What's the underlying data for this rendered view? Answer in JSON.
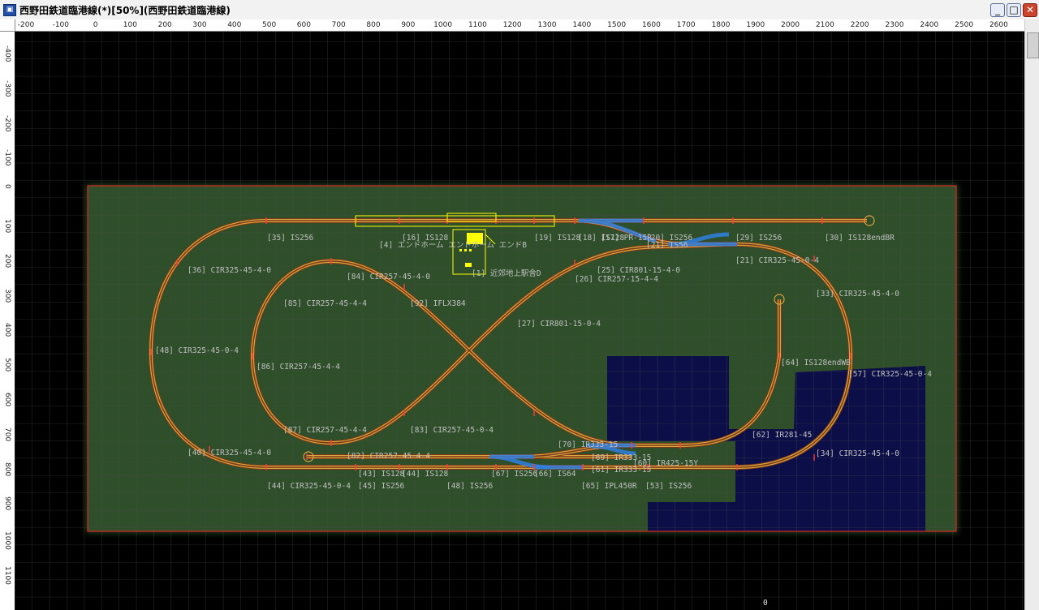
{
  "window": {
    "title": "西野田鉄道臨港線(*)[50%](西野田鉄道臨港線)",
    "app_icon": "train-icon",
    "minimize": "_",
    "maximize": "□",
    "close": "✕"
  },
  "ruler": {
    "x_ticks": [
      "-200",
      "-100",
      "0",
      "100",
      "200",
      "300",
      "400",
      "500",
      "600",
      "700",
      "800",
      "900",
      "1000",
      "1100",
      "1200",
      "1300",
      "1400",
      "1500",
      "1600",
      "1700",
      "1800",
      "1900",
      "2000",
      "2100",
      "2200",
      "2300",
      "2400",
      "2500",
      "2600"
    ],
    "y_ticks": [
      "-400",
      "-300",
      "-200",
      "-100",
      "0",
      "100",
      "200",
      "300",
      "400",
      "500",
      "600",
      "700",
      "800",
      "900",
      "1000",
      "1100"
    ]
  },
  "colors": {
    "board": "#2e4f2a",
    "water": "#0c0e47",
    "track_rail": "#d9a441",
    "track_sleeper": "#7a3a16",
    "turnout": "#2f7fe0",
    "joint": "#ff3a3a",
    "board_border": "#ff2222",
    "station": "#ffff00"
  },
  "track_labels": [
    {
      "id": "l35",
      "text": "[35] IS256"
    },
    {
      "id": "l36",
      "text": "[36] CIR325-45-4-0"
    },
    {
      "id": "l48a",
      "text": "[48] CIR325-45-0-4"
    },
    {
      "id": "l84",
      "text": "[84] CIR257-45-4-0"
    },
    {
      "id": "l85",
      "text": "[85] CIR257-45-4-4"
    },
    {
      "id": "l86",
      "text": "[86] CIR257-45-4-4"
    },
    {
      "id": "l87",
      "text": "[87] CIR257-45-4-4"
    },
    {
      "id": "l92",
      "text": "[92] IFLX384"
    },
    {
      "id": "l27",
      "text": "[27] CIR801-15-0-4"
    },
    {
      "id": "l25",
      "text": "[25] CIR801-15-4-0"
    },
    {
      "id": "l26",
      "text": "[26] CIR257-15-4-4"
    },
    {
      "id": "l4",
      "text": "[4] エンドホーム  エンドホーム  エンドB"
    },
    {
      "id": "l16",
      "text": "[16] IS128"
    },
    {
      "id": "l19",
      "text": "[19] IS128"
    },
    {
      "id": "l18",
      "text": "[18] IS128"
    },
    {
      "id": "l17",
      "text": "[17] PR-15R"
    },
    {
      "id": "l20",
      "text": "[20] IS256"
    },
    {
      "id": "l21x",
      "text": "[21] IS56"
    },
    {
      "id": "l29",
      "text": "[29] IS256"
    },
    {
      "id": "l30",
      "text": "[30] IS128endBR"
    },
    {
      "id": "l21",
      "text": "[21] CIR325-45-0-4"
    },
    {
      "id": "l1",
      "text": "[1] 近郊地上駅舎D"
    },
    {
      "id": "l33",
      "text": "[33] CIR325-45-4-0"
    },
    {
      "id": "l64",
      "text": "[64] IS128endWB"
    },
    {
      "id": "l57",
      "text": "[57] CIR325-45-0-4"
    },
    {
      "id": "l62",
      "text": "[62] IR281-45"
    },
    {
      "id": "l34",
      "text": "[34] CIR325-45-4-0"
    },
    {
      "id": "l83",
      "text": "[83] CIR257-45-0-4"
    },
    {
      "id": "l70",
      "text": "[70] IR333-15"
    },
    {
      "id": "l69",
      "text": "[69] IR333-15"
    },
    {
      "id": "l60",
      "text": "[60] IR425-15Y"
    },
    {
      "id": "l61",
      "text": "[61] IR333-15"
    },
    {
      "id": "l40",
      "text": "[40] CIR325-45-4-0"
    },
    {
      "id": "l82",
      "text": "[82] CIR257-45-4-4"
    },
    {
      "id": "l43",
      "text": "[43] IS128"
    },
    {
      "id": "l44",
      "text": "[44] IS128"
    },
    {
      "id": "l67",
      "text": "[67] IS256"
    },
    {
      "id": "l66",
      "text": "[66] IS64"
    },
    {
      "id": "l44b",
      "text": "[44] CIR325-45-0-4"
    },
    {
      "id": "l45",
      "text": "[45] IS256"
    },
    {
      "id": "l48",
      "text": "[48] IS256"
    },
    {
      "id": "l65",
      "text": "[65] IPL450R"
    },
    {
      "id": "l53",
      "text": "[53] IS256"
    }
  ],
  "origin_marker": "0"
}
